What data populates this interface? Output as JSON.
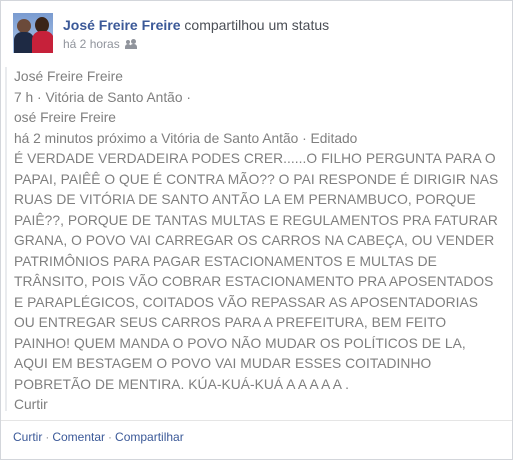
{
  "header": {
    "author": "José Freire Freire",
    "action": "compartilhou um status",
    "time": "há 2 horas",
    "audience_icon": "friends-icon"
  },
  "shared": {
    "author": "José Freire Freire",
    "meta": "7 h · Vitória de Santo Antão ·",
    "original_author": "osé Freire Freire",
    "original_meta": "há 2 minutos próximo a Vitória de Santo Antão · Editado",
    "text": "É VERDADE VERDADEIRA PODES CRER......O FILHO PERGUNTA PARA O PAPAI, PAIÊÊ O QUE É CONTRA MÃO?? O PAI RESPONDE É DIRIGIR NAS RUAS DE VITÓRIA DE SANTO ANTÃO LA EM PERNAMBUCO, PORQUE PAIÊ??, PORQUE DE TANTAS MULTAS E REGULAMENTOS PRA FATURAR GRANA, O POVO VAI CARREGAR OS CARROS NA CABEÇA, OU VENDER PATRIMÔNIOS PARA PAGAR ESTACIONAMENTOS E MULTAS DE TRÂNSITO, POIS VÃO COBRAR ESTACIONAMENTO PRA APOSENTADOS E PARAPLÉGICOS, COITADOS VÃO REPASSAR AS APOSENTADORIAS OU ENTREGAR SEUS CARROS PARA A PREFEITURA, BEM FEITO PAINHO! QUEM MANDA O POVO NÃO MUDAR OS POLÍTICOS DE LA, AQUI EM BESTAGEM O POVO VAI MUDAR ESSES COITADINHO POBRETÃO DE MENTIRA. KÚA-KUÁ-KUÁ A A A A A .",
    "like": "Curtir"
  },
  "footer": {
    "like": "Curtir",
    "comment": "Comentar",
    "share": "Compartilhar",
    "separator": "·"
  },
  "colors": {
    "link": "#3b5998",
    "muted": "#90949c",
    "body": "#7f7f7f"
  }
}
